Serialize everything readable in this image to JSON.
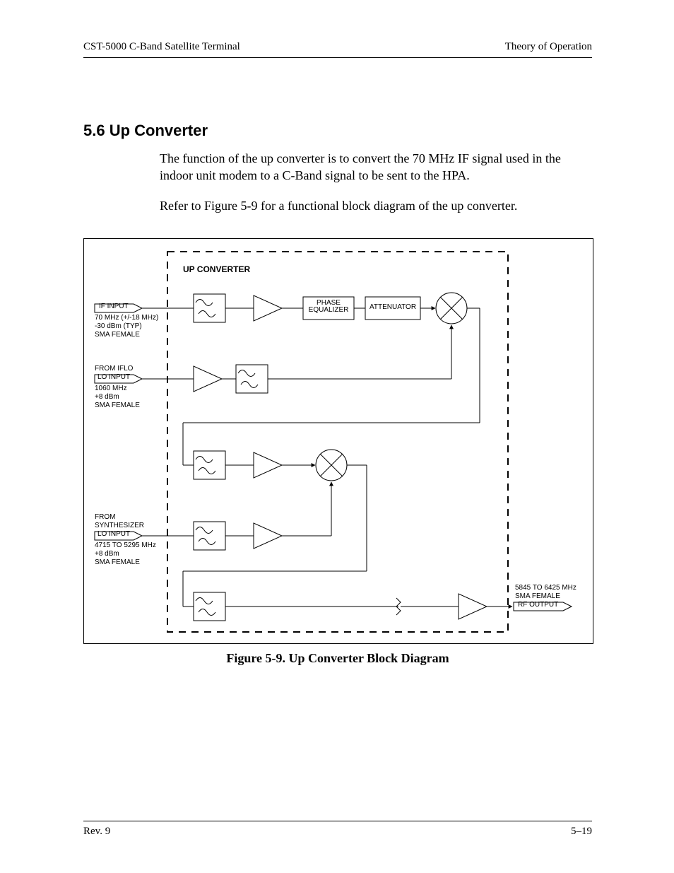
{
  "header": {
    "left": "CST-5000 C-Band Satellite Terminal",
    "right": "Theory of Operation"
  },
  "section": {
    "number_title": "5.6  Up Converter",
    "para1": "The function of the up converter is to convert the 70 MHz IF signal used in the indoor unit modem to a C-Band signal to be sent to the HPA.",
    "para2": "Refer to Figure 5-9 for a functional block diagram of the up converter."
  },
  "diagram": {
    "title": "UP CONVERTER",
    "if_input_label": "IF INPUT",
    "if_input_details1": "70 MHz (+/-18 MHz)",
    "if_input_details2": "-30 dBm  (TYP)",
    "if_input_details3": "SMA FEMALE",
    "lo1_from": "FROM IFLO",
    "lo1_label": "LO INPUT",
    "lo1_details1": "1060 MHz",
    "lo1_details2": "+8 dBm",
    "lo1_details3": "SMA FEMALE",
    "lo2_from1": "FROM",
    "lo2_from2": "SYNTHESIZER",
    "lo2_label": "LO INPUT",
    "lo2_details1": "4715 TO 5295 MHz",
    "lo2_details2": "+8 dBm",
    "lo2_details3": "SMA FEMALE",
    "phase_eq": "PHASE\nEQUALIZER",
    "attenuator": "ATTENUATOR",
    "rf_output": "RF OUTPUT",
    "rf_details1": "5845 TO 6425 MHz",
    "rf_details2": "SMA FEMALE"
  },
  "figure_caption": "Figure 5-9.  Up Converter Block Diagram",
  "footer": {
    "left": "Rev. 9",
    "right": "5–19"
  }
}
